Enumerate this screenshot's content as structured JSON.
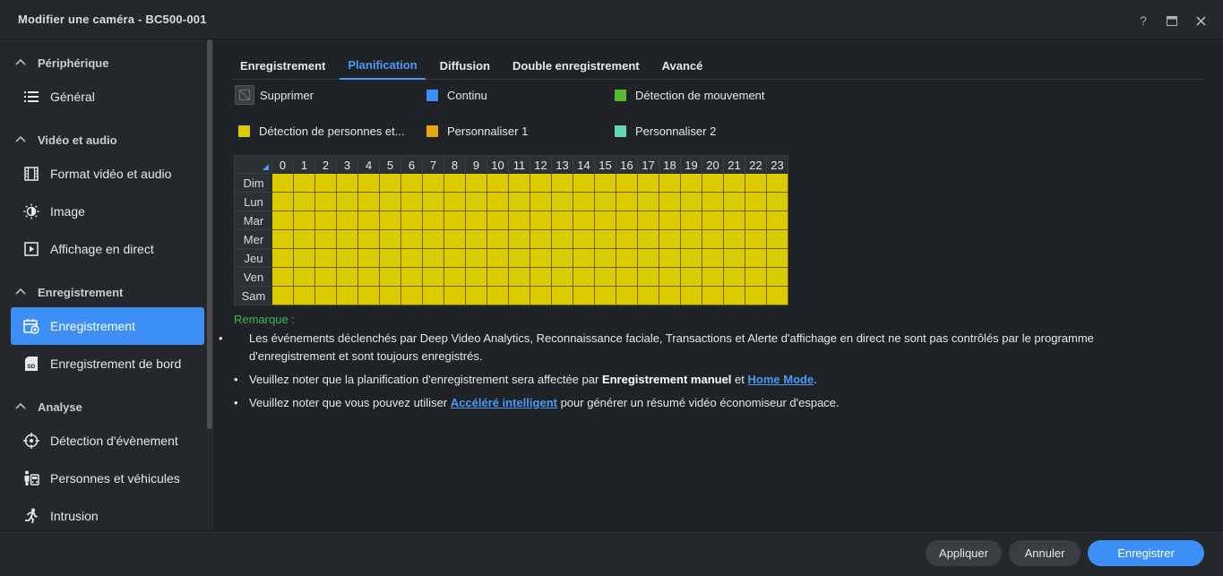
{
  "window": {
    "title": "Modifier une caméra - BC500-001"
  },
  "sidebar": {
    "sections": [
      {
        "label": "Périphérique",
        "items": [
          {
            "label": "Général",
            "icon": "list-icon"
          }
        ]
      },
      {
        "label": "Vidéo et audio",
        "items": [
          {
            "label": "Format vidéo et audio",
            "icon": "film-icon"
          },
          {
            "label": "Image",
            "icon": "brightness-icon"
          },
          {
            "label": "Affichage en direct",
            "icon": "play-icon"
          }
        ]
      },
      {
        "label": "Enregistrement",
        "items": [
          {
            "label": "Enregistrement",
            "icon": "calendar-record-icon",
            "active": true
          },
          {
            "label": "Enregistrement de bord",
            "icon": "sd-card-icon"
          }
        ]
      },
      {
        "label": "Analyse",
        "items": [
          {
            "label": "Détection d'évènement",
            "icon": "crosshair-icon"
          },
          {
            "label": "Personnes et véhicules",
            "icon": "person-vehicle-icon"
          },
          {
            "label": "Intrusion",
            "icon": "running-person-icon"
          }
        ]
      }
    ]
  },
  "tabs": [
    {
      "label": "Enregistrement",
      "active": false
    },
    {
      "label": "Planification",
      "active": true
    },
    {
      "label": "Diffusion",
      "active": false
    },
    {
      "label": "Double enregistrement",
      "active": false
    },
    {
      "label": "Avancé",
      "active": false
    }
  ],
  "legend": [
    {
      "label": "Supprimer",
      "color": "eraser"
    },
    {
      "label": "Continu",
      "color": "#3d8ef5"
    },
    {
      "label": "Détection de mouvement",
      "color": "#5cb82c"
    },
    {
      "label": "Détection de personnes et...",
      "color": "#ddcc00"
    },
    {
      "label": "Personnaliser 1",
      "color": "#e8a317"
    },
    {
      "label": "Personnaliser 2",
      "color": "#67d4b4"
    }
  ],
  "schedule": {
    "hours": [
      "0",
      "1",
      "2",
      "3",
      "4",
      "5",
      "6",
      "7",
      "8",
      "9",
      "10",
      "11",
      "12",
      "13",
      "14",
      "15",
      "16",
      "17",
      "18",
      "19",
      "20",
      "21",
      "22",
      "23"
    ],
    "days": [
      "Dim",
      "Lun",
      "Mar",
      "Mer",
      "Jeu",
      "Ven",
      "Sam"
    ],
    "fill_mode": "Détection de personnes et...",
    "fill_color": "#ddcc00"
  },
  "remarks": {
    "title": "Remarque :",
    "bullet": "•",
    "note1": "Les événements déclenchés par Deep Video Analytics, Reconnaissance faciale, Transactions et Alerte d'affichage en direct ne sont pas contrôlés par le programme d'enregistrement et sont toujours enregistrés.",
    "note2_pre": "Veuillez noter que la planification d'enregistrement sera affectée par ",
    "note2_bold": "Enregistrement manuel",
    "note2_mid": " et ",
    "note2_link": "Home Mode",
    "note2_post": ".",
    "note3_pre": "Veuillez noter que vous pouvez utiliser ",
    "note3_link": "Accéléré intelligent",
    "note3_post": " pour générer un résumé vidéo économiseur d'espace."
  },
  "footer": {
    "apply": "Appliquer",
    "cancel": "Annuler",
    "save": "Enregistrer"
  }
}
